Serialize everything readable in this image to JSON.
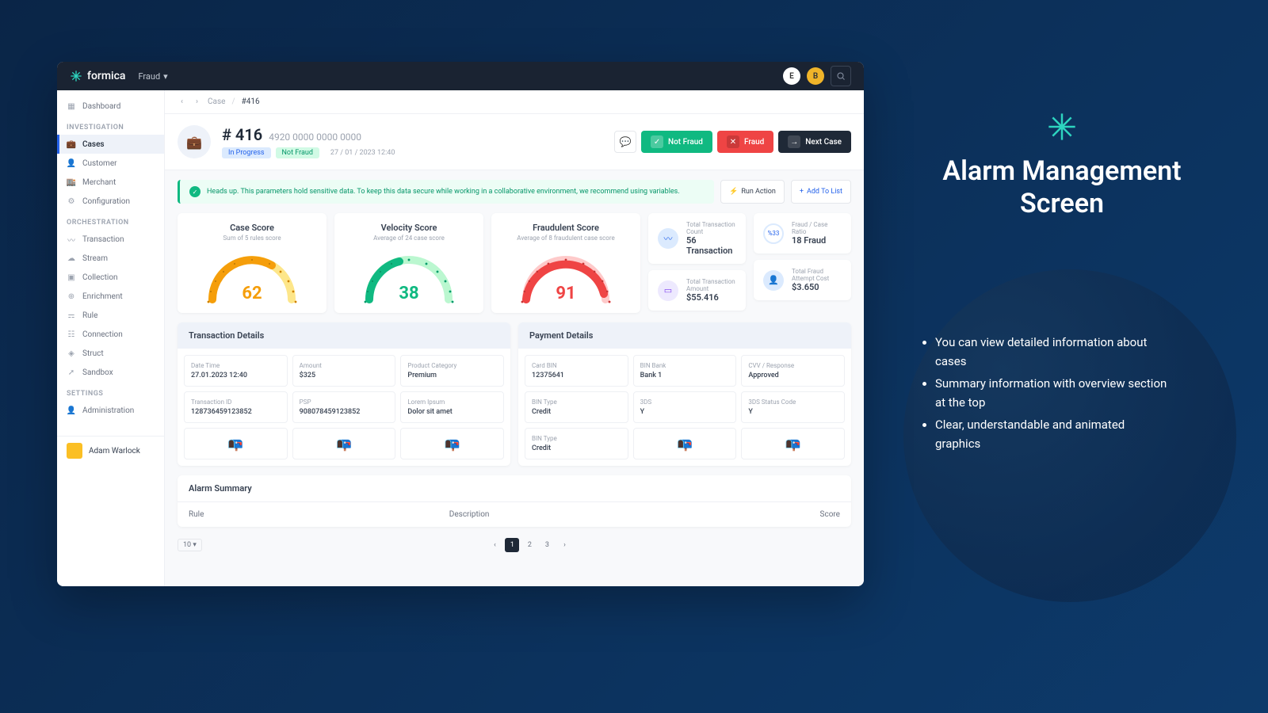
{
  "brand": "formica",
  "topbar": {
    "dropdown": "Fraud",
    "avatar_e": "E",
    "avatar_b": "B"
  },
  "sidebar": {
    "items": [
      {
        "label": "Dashboard"
      },
      {
        "section": "INVESTIGATION"
      },
      {
        "label": "Cases",
        "active": true
      },
      {
        "label": "Customer"
      },
      {
        "label": "Merchant"
      },
      {
        "label": "Configuration"
      },
      {
        "section": "ORCHESTRATION"
      },
      {
        "label": "Transaction"
      },
      {
        "label": "Stream"
      },
      {
        "label": "Collection"
      },
      {
        "label": "Enrichment"
      },
      {
        "label": "Rule"
      },
      {
        "label": "Connection"
      },
      {
        "label": "Struct"
      },
      {
        "label": "Sandbox"
      },
      {
        "section": "SETTINGS"
      },
      {
        "label": "Administration"
      }
    ],
    "user": "Adam Warlock"
  },
  "breadcrumb": {
    "case": "Case",
    "id": "#416"
  },
  "case": {
    "title": "# 416",
    "number": "4920 0000 0000 0000",
    "tags": {
      "progress": "In Progress",
      "status": "Not Fraud",
      "date": "27 / 01 / 2023   12:40"
    },
    "actions": {
      "not_fraud": "Not Fraud",
      "fraud": "Fraud",
      "next": "Next Case"
    }
  },
  "alert": {
    "text": "Heads up. This parameters hold sensitive data. To keep this data secure while working in a collaborative environment, we recommend using variables.",
    "run_action": "Run Action",
    "add_to_list": "Add To List"
  },
  "scores": {
    "case": {
      "title": "Case Score",
      "sub": "Sum of 5 rules score",
      "value": "62"
    },
    "velocity": {
      "title": "Velocity Score",
      "sub": "Average of 24 case score",
      "value": "38"
    },
    "fraudulent": {
      "title": "Fraudulent Score",
      "sub": "Average of 8 fraudulent case score",
      "value": "91"
    }
  },
  "stats": {
    "tx_count": {
      "label": "Total Transaction Count",
      "value": "56 Transaction"
    },
    "fraud_ratio": {
      "label": "Fraud / Case Ratio",
      "value": "18 Fraud",
      "pct": "%33"
    },
    "tx_amount": {
      "label": "Total Transaction Amount",
      "value": "$55.416"
    },
    "fraud_cost": {
      "label": "Total Fraud Attempt Cost",
      "value": "$3.650"
    }
  },
  "transaction_details": {
    "title": "Transaction Details",
    "cells": [
      {
        "label": "Date Time",
        "value": "27.01.2023  12:40"
      },
      {
        "label": "Amount",
        "value": "$325"
      },
      {
        "label": "Product Category",
        "value": "Premium"
      },
      {
        "label": "Transaction ID",
        "value": "128736459123852"
      },
      {
        "label": "PSP",
        "value": "908078459123852"
      },
      {
        "label": "Lorem Ipsum",
        "value": "Dolor sit amet"
      }
    ]
  },
  "payment_details": {
    "title": "Payment Details",
    "cells": [
      {
        "label": "Card BIN",
        "value": "12375641"
      },
      {
        "label": "BIN Bank",
        "value": "Bank 1"
      },
      {
        "label": "CVV / Response",
        "value": "Approved"
      },
      {
        "label": "BIN Type",
        "value": "Credit"
      },
      {
        "label": "3DS",
        "value": "Y"
      },
      {
        "label": "3DS Status Code",
        "value": "Y"
      },
      {
        "label": "BIN Type",
        "value": "Credit"
      }
    ]
  },
  "alarm": {
    "title": "Alarm Summary",
    "cols": {
      "rule": "Rule",
      "description": "Description",
      "score": "Score"
    }
  },
  "pagination": {
    "size": "10",
    "pages": [
      "1",
      "2",
      "3"
    ]
  },
  "promo": {
    "title1": "Alarm Management",
    "title2": "Screen",
    "bullets": [
      "You can view detailed information about cases",
      "Summary information with overview section at the top",
      "Clear, understandable and animated graphics"
    ]
  }
}
